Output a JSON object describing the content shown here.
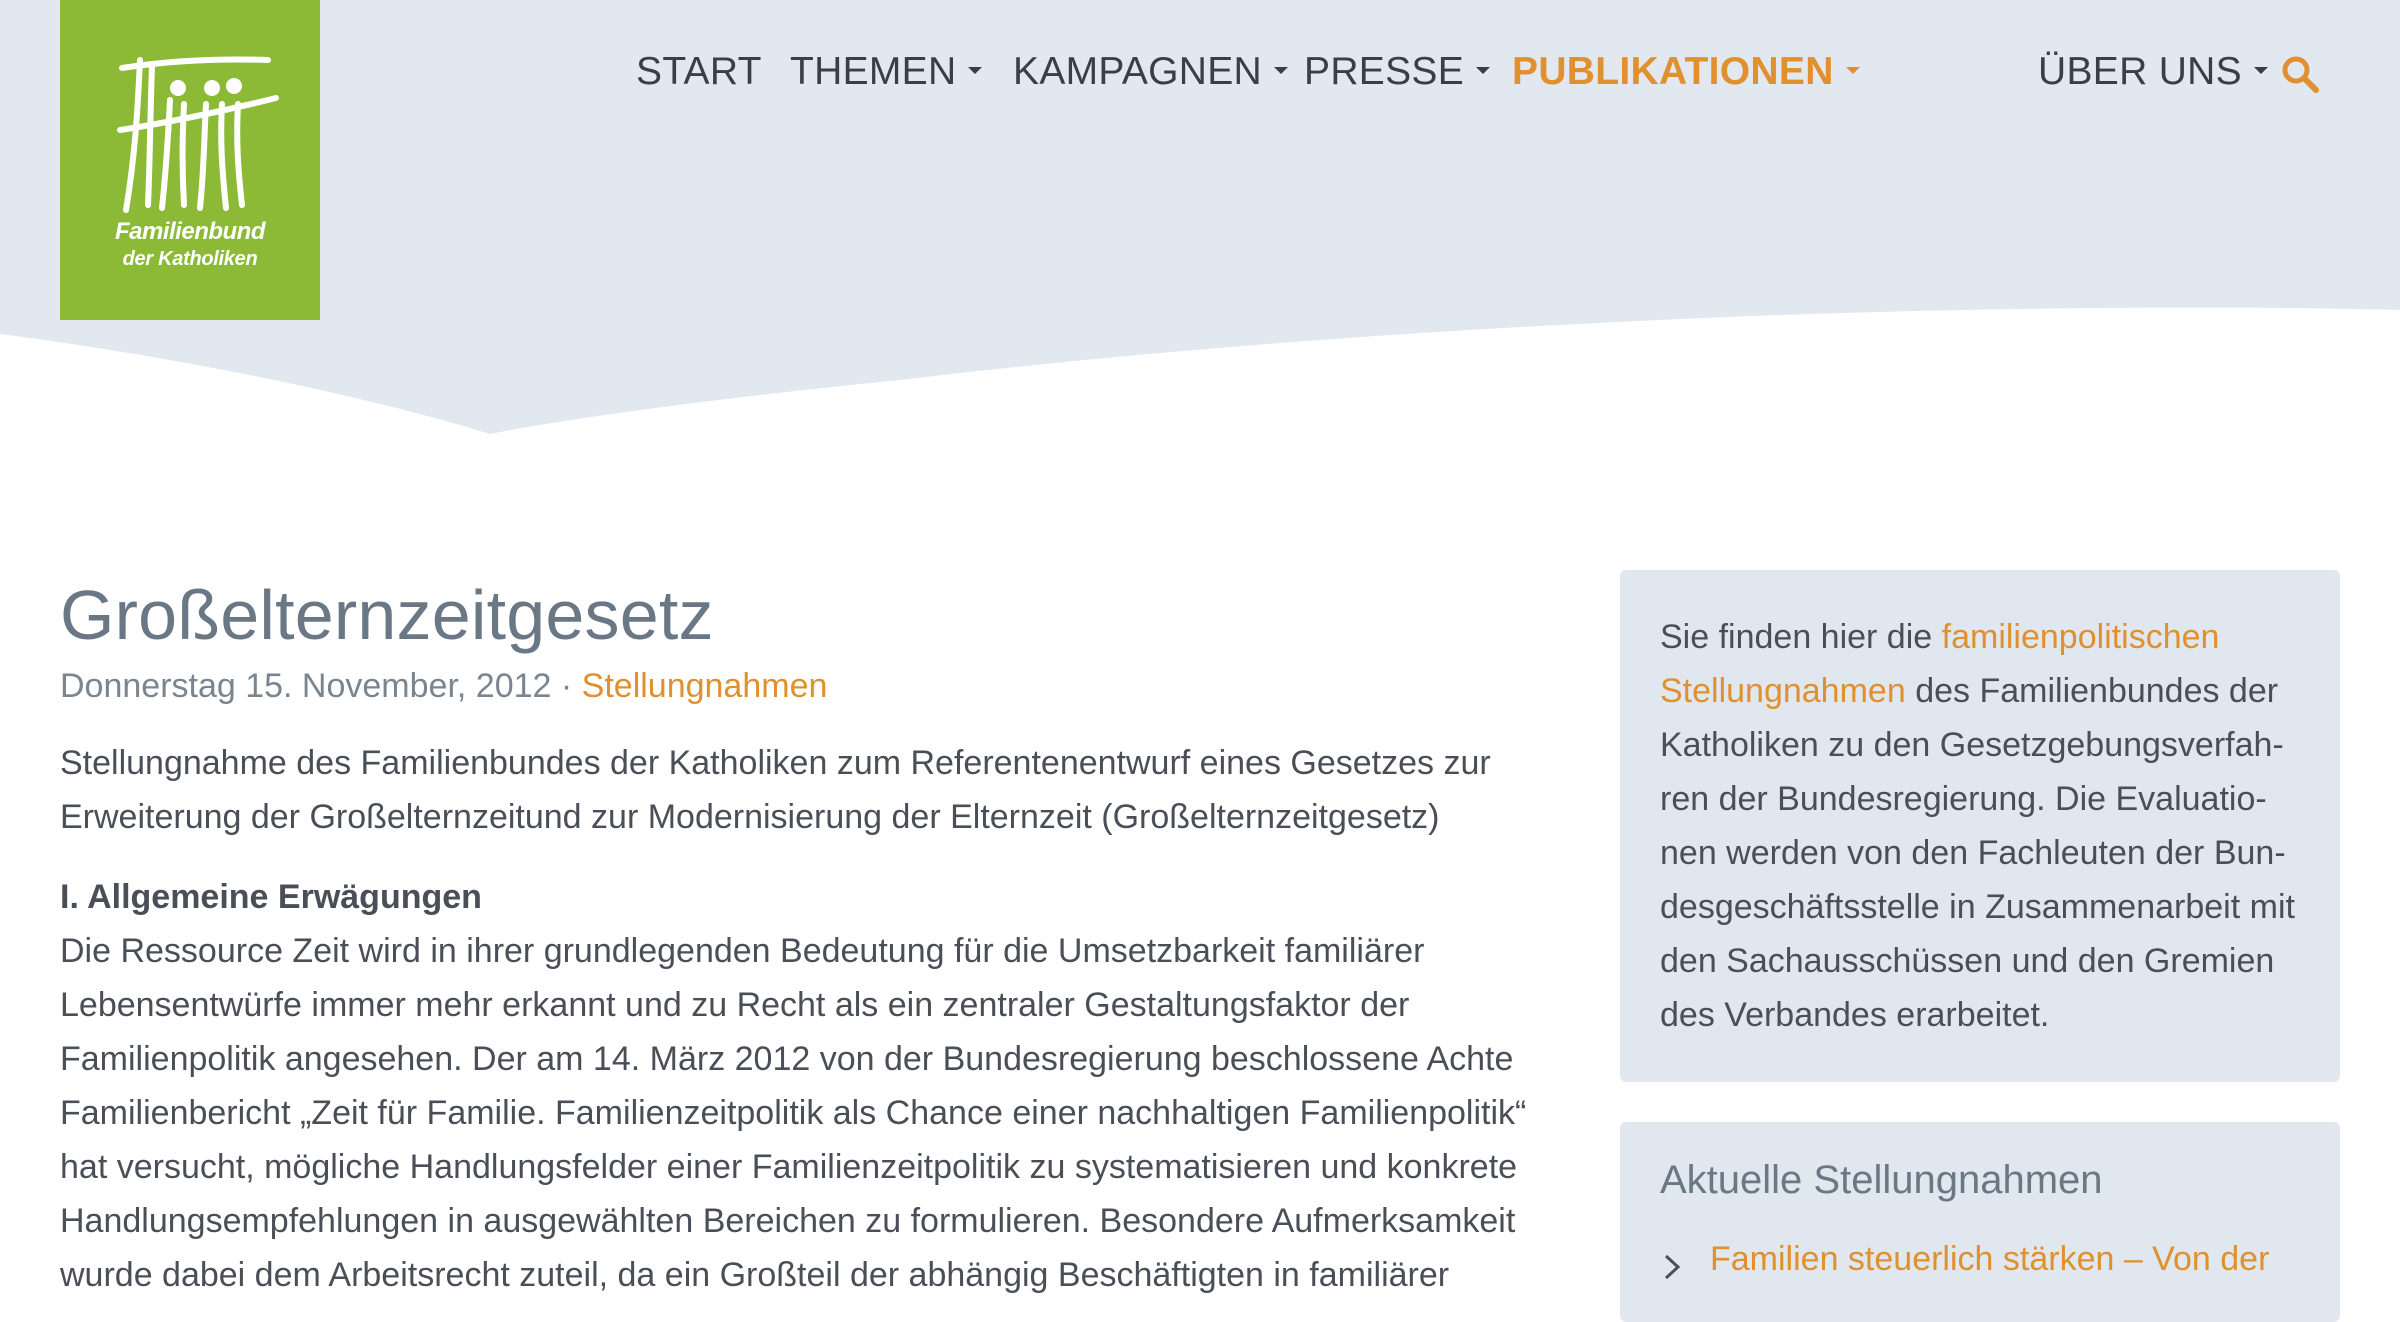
{
  "logo": {
    "line1": "Familienbund",
    "line2": "der Katholiken",
    "background": "#8cba36"
  },
  "nav": {
    "items": [
      {
        "label": "START",
        "dropdown": false,
        "active": false
      },
      {
        "label": "THEMEN",
        "dropdown": true,
        "active": false
      },
      {
        "label": "KAMPAGNEN",
        "dropdown": true,
        "active": false
      },
      {
        "label": "PRESSE",
        "dropdown": true,
        "active": false
      },
      {
        "label": "PUBLIKATIONEN",
        "dropdown": true,
        "active": true
      },
      {
        "label": "ÜBER UNS",
        "dropdown": true,
        "active": false
      }
    ],
    "search_icon": "search-icon"
  },
  "colors": {
    "accent": "#e0902e",
    "header_bg": "#e1e8ef",
    "box_bg": "#e0e7ee",
    "title": "#6a7785"
  },
  "article": {
    "title": "Großelternzeitgesetz",
    "date": "Donnerstag 15. November, 2012",
    "separator": " · ",
    "category": "Stellungnahmen",
    "intro": "Stellungnahme des Familienbundes der Katholiken zum Referentenentwurf eines Gesetzes zur Erweiterung der Großelternzeitund zur Modernisierung der Elternzeit (Großelternzeitgesetz)",
    "section_heading": "I. Allgemeine Erwägungen",
    "section_text": "Die Ressource Zeit wird in ihrer grundlegenden Bedeutung für die Umsetzbarkeit familiärer Lebensentwürfe immer mehr erkannt und zu Recht als ein zentraler Gestaltungsfaktor der Familienpolitik angesehen. Der am 14. März 2012 von der Bundesregierung beschlossene Achte Familienbericht „Zeit für Familie. Familienzeitpolitik als Chance einer nachhaltigen Familienpolitik“ hat versucht, mögliche Handlungsfelder einer Familienzeitpolitik zu systematisieren und konkrete Handlungsempfehlungen in ausgewählten Bereichen zu formulieren. Besondere Aufmerksamkeit wurde dabei dem Arbeitsrecht zuteil, da ein Großteil der abhängig Beschäftigten in familiärer"
  },
  "sidebar": {
    "info_prefix": "Sie finden hier die ",
    "info_link": "familienpolitischen Stellungnahmen",
    "info_suffix": " des Familienbundes der Katholiken zu den Gesetzgebungsverfah­ren der Bundesregierung. Die Evaluatio­nen werden von den Fachleuten der Bun­desgeschäftsstelle in Zusammenarbeit mit den Sachausschüssen und den Gremien des Verbandes erarbeitet.",
    "recent_heading": "Aktuelle Stellungnahmen",
    "recent_items": [
      {
        "label": "Familien steuerlich stärken – Von der"
      }
    ]
  }
}
